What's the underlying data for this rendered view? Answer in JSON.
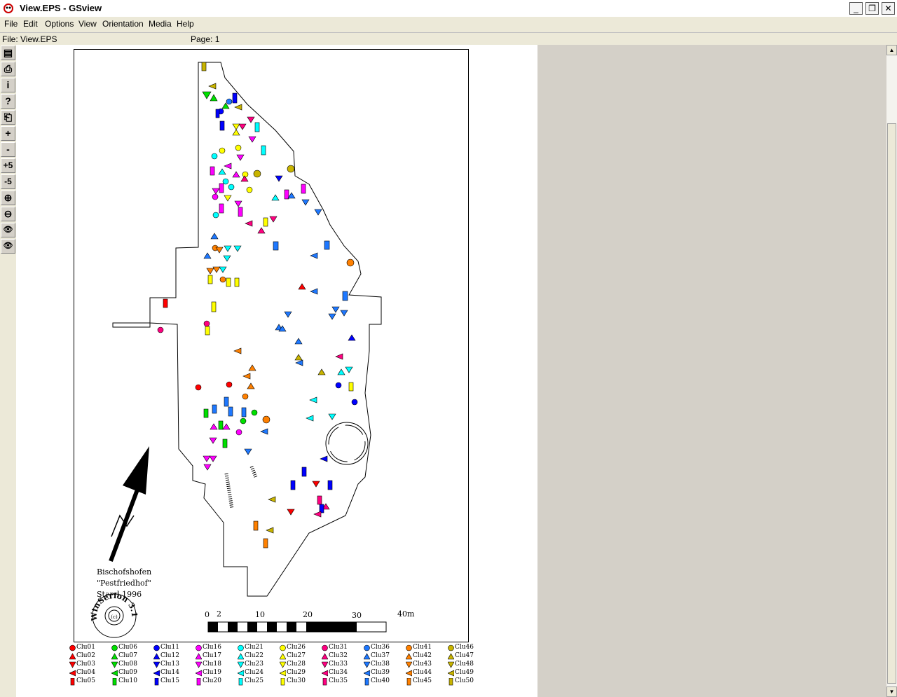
{
  "window": {
    "title": "View.EPS - GSview"
  },
  "menu": [
    "File",
    "Edit",
    "Options",
    "View",
    "Orientation",
    "Media",
    "Help"
  ],
  "status": {
    "file": "File: View.EPS",
    "page": "Page: 1"
  },
  "toolbar": {
    "buttons": [
      {
        "name": "open-icon",
        "glyph": "▤"
      },
      {
        "name": "print-icon",
        "glyph": "⎙"
      },
      {
        "name": "info-icon",
        "glyph": "i"
      },
      {
        "name": "help-icon",
        "glyph": "?"
      },
      {
        "name": "goto-page-icon",
        "glyph": "⎗"
      },
      {
        "name": "next-page-icon",
        "glyph": "+"
      },
      {
        "name": "prev-page-icon",
        "glyph": "-"
      },
      {
        "name": "skip-forward-icon",
        "glyph": "+5"
      },
      {
        "name": "skip-back-icon",
        "glyph": "-5"
      },
      {
        "name": "zoom-in-icon",
        "glyph": "⊕"
      },
      {
        "name": "zoom-out-icon",
        "glyph": "⊖"
      },
      {
        "name": "text-extract-icon",
        "glyph": "👁"
      },
      {
        "name": "find-icon",
        "glyph": "👁"
      }
    ]
  },
  "map": {
    "caption1": "Bischofshofen",
    "caption2": "\"Pestfriedhof\"",
    "caption3": "Stand 1996",
    "seal": "WinSerion 3.1",
    "seal_center": "(c)",
    "scale_labels": [
      "0",
      "2",
      "10",
      "20",
      "30",
      "40m"
    ]
  },
  "legend": {
    "symbols": [
      "circle",
      "triangle-up",
      "triangle-down",
      "triangle-left",
      "rect"
    ],
    "columns": [
      {
        "color": "#ff0000",
        "items": [
          "Clu01",
          "Clu02",
          "Clu03",
          "Clu04",
          "Clu05"
        ]
      },
      {
        "color": "#00e000",
        "items": [
          "Clu06",
          "Clu07",
          "Clu08",
          "Clu09",
          "Clu10"
        ]
      },
      {
        "color": "#0000ff",
        "items": [
          "Clu11",
          "Clu12",
          "Clu13",
          "Clu14",
          "Clu15"
        ]
      },
      {
        "color": "#ff00ff",
        "items": [
          "Clu16",
          "Clu17",
          "Clu18",
          "Clu19",
          "Clu20"
        ]
      },
      {
        "color": "#00ffff",
        "items": [
          "Clu21",
          "Clu22",
          "Clu23",
          "Clu24",
          "Clu25"
        ]
      },
      {
        "color": "#ffff00",
        "items": [
          "Clu26",
          "Clu27",
          "Clu28",
          "Clu29",
          "Clu30"
        ]
      },
      {
        "color": "#ff0080",
        "items": [
          "Clu31",
          "Clu32",
          "Clu33",
          "Clu34",
          "Clu35"
        ]
      },
      {
        "color": "#1e78ff",
        "items": [
          "Clu36",
          "Clu37",
          "Clu38",
          "Clu39",
          "Clu40"
        ]
      },
      {
        "color": "#ff8000",
        "items": [
          "Clu41",
          "Clu42",
          "Clu43",
          "Clu44",
          "Clu45"
        ]
      },
      {
        "color": "#c8b400",
        "items": [
          "Clu46",
          "Clu47",
          "Clu48",
          "Clu49",
          "Clu50"
        ]
      }
    ]
  }
}
